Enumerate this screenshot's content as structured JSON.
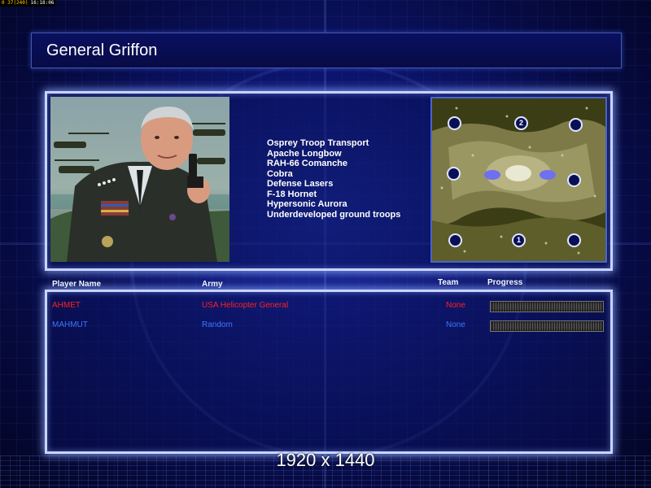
{
  "status_bar": {
    "fps": "0 37(240)",
    "clock": "16:18:06"
  },
  "screen_title": "General Griffon",
  "general_units": [
    "Osprey Troop Transport",
    "Apache Longbow",
    "RAH-66 Comanche",
    "Cobra",
    "Defense Lasers",
    "F-18 Hornet",
    "Hypersonic Aurora",
    "Underdeveloped ground troops"
  ],
  "minimap": {
    "start_markers": [
      "",
      "2",
      "",
      "",
      "",
      "",
      "1",
      ""
    ]
  },
  "players_table": {
    "headers": {
      "name": "Player Name",
      "army": "Army",
      "team": "Team",
      "progress": "Progress"
    },
    "rows": [
      {
        "name": "AHMET",
        "army": "USA Helicopter General",
        "team": "None",
        "progress": 0.0,
        "color": "#ff2020"
      },
      {
        "name": "MAHMUT",
        "army": "Random",
        "team": "None",
        "progress": 0.0,
        "color": "#3c78ff"
      }
    ]
  },
  "resolution_label": "1920 x 1440",
  "colors": {
    "panel_border": "#c8d4ff",
    "background": "#0d1670",
    "player1": "#ff2020",
    "player2": "#3c78ff"
  }
}
